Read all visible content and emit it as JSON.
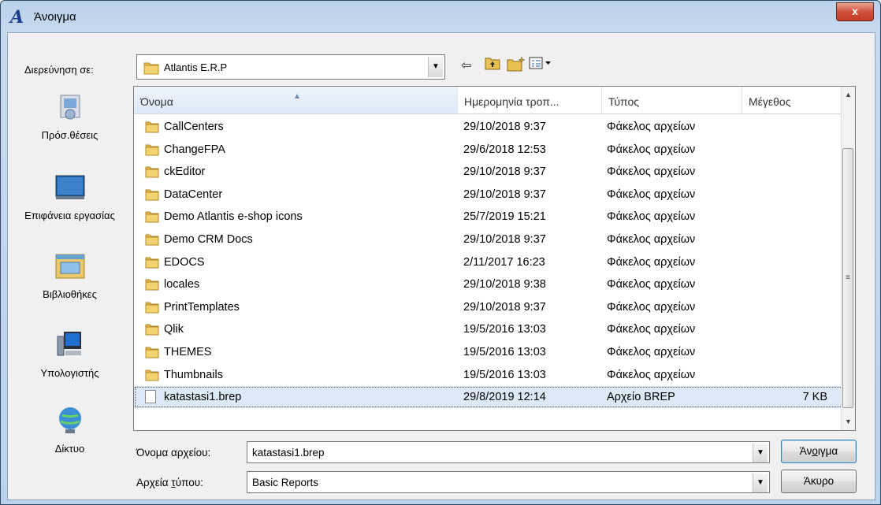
{
  "window": {
    "title": "Άνοιγμα",
    "close": "x"
  },
  "lookin": {
    "label": "Διερεύνηση σε:",
    "value": "Atlantis E.R.P"
  },
  "toolbar": {
    "back": "⇦",
    "up": "▣",
    "newfolder": "✱",
    "views": "▤▾"
  },
  "places": [
    {
      "label": "Πρόσ.θέσεις",
      "icon": "recent-places-icon"
    },
    {
      "label": "Επιφάνεια εργασίας",
      "icon": "desktop-icon"
    },
    {
      "label": "Βιβλιοθήκες",
      "icon": "libraries-icon"
    },
    {
      "label": "Υπολογιστής",
      "icon": "computer-icon"
    },
    {
      "label": "Δίκτυο",
      "icon": "network-icon"
    }
  ],
  "columns": {
    "name": "Όνομα",
    "date": "Ημερομηνία τροπ...",
    "type": "Τύπος",
    "size": "Μέγεθος"
  },
  "files": [
    {
      "name": "CallCenters",
      "date": "29/10/2018 9:37",
      "type": "Φάκελος αρχείων",
      "size": ""
    },
    {
      "name": "ChangeFPA",
      "date": "29/6/2018 12:53",
      "type": "Φάκελος αρχείων",
      "size": ""
    },
    {
      "name": "ckEditor",
      "date": "29/10/2018 9:37",
      "type": "Φάκελος αρχείων",
      "size": ""
    },
    {
      "name": "DataCenter",
      "date": "29/10/2018 9:37",
      "type": "Φάκελος αρχείων",
      "size": ""
    },
    {
      "name": "Demo Atlantis e-shop icons",
      "date": "25/7/2019 15:21",
      "type": "Φάκελος αρχείων",
      "size": ""
    },
    {
      "name": "Demo CRM Docs",
      "date": "29/10/2018 9:37",
      "type": "Φάκελος αρχείων",
      "size": ""
    },
    {
      "name": "EDOCS",
      "date": "2/11/2017 16:23",
      "type": "Φάκελος αρχείων",
      "size": ""
    },
    {
      "name": "locales",
      "date": "29/10/2018 9:38",
      "type": "Φάκελος αρχείων",
      "size": ""
    },
    {
      "name": "PrintTemplates",
      "date": "29/10/2018 9:37",
      "type": "Φάκελος αρχείων",
      "size": ""
    },
    {
      "name": "Qlik",
      "date": "19/5/2016 13:03",
      "type": "Φάκελος αρχείων",
      "size": ""
    },
    {
      "name": "THEMES",
      "date": "19/5/2016 13:03",
      "type": "Φάκελος αρχείων",
      "size": ""
    },
    {
      "name": "Thumbnails",
      "date": "19/5/2016 13:03",
      "type": "Φάκελος αρχείων",
      "size": ""
    },
    {
      "name": "katastasi1.brep",
      "date": "29/8/2019 12:14",
      "type": "Αρχείο BREP",
      "size": "7 KB"
    }
  ],
  "filename": {
    "label_a": "Όνομα αρ",
    "label_u": "χ",
    "label_b": "είου:",
    "value": "katastasi1.brep"
  },
  "filetype": {
    "label_a": "Αρχεία ",
    "label_u": "τ",
    "label_b": "ύπου:",
    "value": "Basic Reports"
  },
  "buttons": {
    "open_a": "Άν",
    "open_u": "ο",
    "open_b": "ιγμα",
    "cancel": "Άκυρο"
  }
}
